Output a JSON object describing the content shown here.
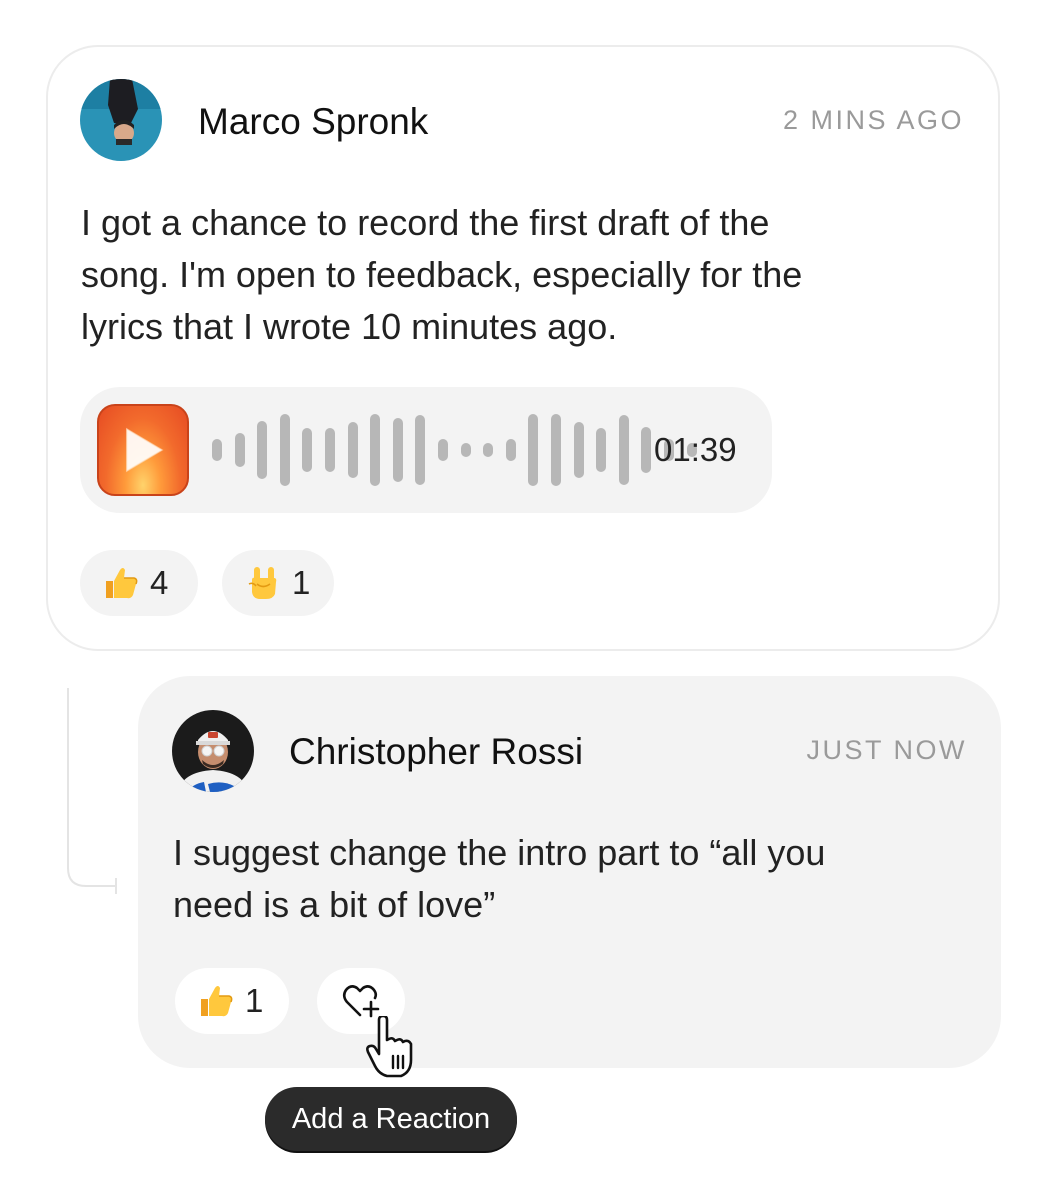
{
  "comment": {
    "author": "Marco Spronk",
    "time": "2 MINS AGO",
    "text_lines": [
      "I got a chance to record the first draft of the",
      "song. I'm open to feedback, especially for the",
      "lyrics that I wrote 10 minutes ago."
    ],
    "audio": {
      "duration": "01:39"
    },
    "reactions": [
      {
        "emoji": "thumbs-up",
        "count": "4"
      },
      {
        "emoji": "rock-on",
        "count": "1"
      }
    ]
  },
  "reply": {
    "author": "Christopher Rossi",
    "time": "JUST NOW",
    "text_lines": [
      "I suggest change the intro part to “all you",
      "need is a bit of love”"
    ],
    "reactions": [
      {
        "emoji": "thumbs-up",
        "count": "1"
      }
    ],
    "add_reaction_icon": "heart-plus-icon"
  },
  "tooltip": {
    "label": "Add a Reaction"
  },
  "colors": {
    "card_border": "#ececec",
    "reply_bg": "#f3f3f3",
    "timestamp": "#9a9a9a",
    "play_accent": "#f26a2c",
    "waveform": "#b7b7b7",
    "tooltip_bg": "#2b2b2b"
  }
}
